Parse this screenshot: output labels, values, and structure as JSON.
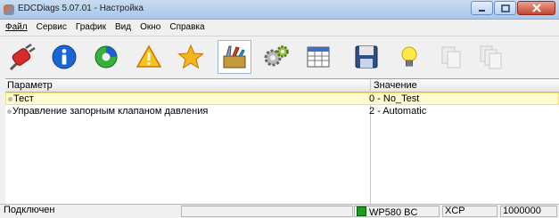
{
  "window": {
    "title": "EDCDiags 5.07.01 - Настройка",
    "colors": {
      "title_gradient": "#a9c6ea",
      "close": "#c74530",
      "selected_row": "#fdfad0",
      "connected_led": "#19a019"
    }
  },
  "menu": [
    {
      "label": "Файл"
    },
    {
      "label": "Сервис"
    },
    {
      "label": "График"
    },
    {
      "label": "Вид"
    },
    {
      "label": "Окно"
    },
    {
      "label": "Справка"
    }
  ],
  "toolbar": {
    "buttons": [
      {
        "icon": "disconnect-plug-icon"
      },
      {
        "icon": "info-icon"
      },
      {
        "icon": "pie-chart-icon"
      },
      {
        "icon": "warning-icon"
      },
      {
        "icon": "star-icon"
      },
      {
        "icon": "tools-icon",
        "active": true
      },
      {
        "icon": "gears-icon"
      },
      {
        "icon": "table-icon"
      },
      {
        "icon": "save-icon"
      },
      {
        "icon": "lightbulb-icon"
      },
      {
        "icon": "copy-disabled-icon"
      },
      {
        "icon": "copy-all-disabled-icon"
      }
    ]
  },
  "grid": {
    "columns": [
      "Параметр",
      "Значение"
    ],
    "rows": [
      {
        "param": "Тест",
        "value": "0 - No_Test",
        "selected": true
      },
      {
        "param": "Управление запорным клапаном давления",
        "value": "2 - Automatic",
        "selected": false
      }
    ]
  },
  "status": {
    "connection": "Подключен",
    "ecu": "WP580 BC",
    "protocol": "XCP",
    "baud": "1000000"
  }
}
